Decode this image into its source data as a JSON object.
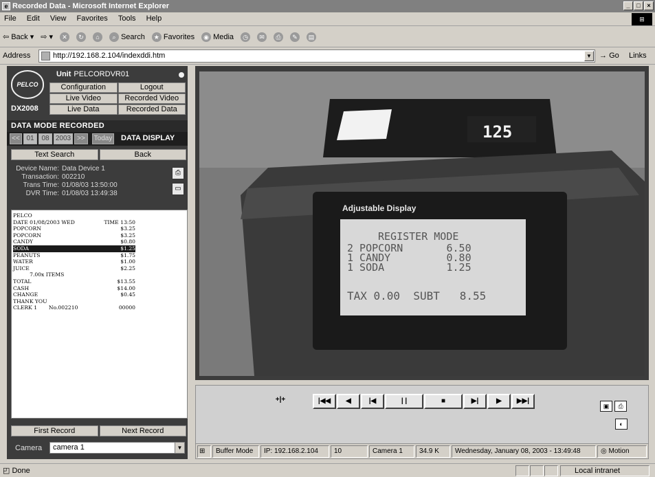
{
  "window": {
    "title": "Recorded Data - Microsoft Internet Explorer"
  },
  "menu": [
    "File",
    "Edit",
    "View",
    "Favorites",
    "Tools",
    "Help"
  ],
  "toolbar": {
    "back": "Back",
    "search": "Search",
    "favorites": "Favorites",
    "media": "Media"
  },
  "address": {
    "label": "Address",
    "url": "http://192.168.2.104/indexddi.htm",
    "go": "Go",
    "links": "Links"
  },
  "unit": {
    "label": "Unit",
    "name": "PELCORDVR01",
    "model": "DX2008",
    "logo": "PELCO"
  },
  "nav": [
    "Configuration",
    "Logout",
    "Live Video",
    "Recorded Video",
    "Live Data",
    "Recorded Data"
  ],
  "mode": "DATA MODE RECORDED",
  "datebar": {
    "prev": "<<",
    "month": "01",
    "day": "08",
    "year": "2003",
    "next": ">>",
    "today": "Today",
    "title": "DATA DISPLAY"
  },
  "actions": {
    "text_search": "Text Search",
    "back": "Back",
    "first_record": "First Record",
    "next_record": "Next Record"
  },
  "device": [
    {
      "k": "Device Name:",
      "v": "Data Device 1"
    },
    {
      "k": "Transaction:",
      "v": "002210"
    },
    {
      "k": "Trans Time:",
      "v": "01/08/03 13:50:00"
    },
    {
      "k": "DVR Time:",
      "v": "01/08/03 13:49:38"
    }
  ],
  "receipt": [
    {
      "l": "PELCO",
      "r": ""
    },
    {
      "l": "DATE 01/08/2003 WED",
      "r": "TIME 13:50"
    },
    {
      "l": "POPCORN",
      "r": "$3.25"
    },
    {
      "l": "POPCORN",
      "r": "$3.25"
    },
    {
      "l": "CANDY",
      "r": "$0.80"
    },
    {
      "l": "SODA",
      "r": "$1.25",
      "selected": true
    },
    {
      "l": "PEANUTS",
      "r": "$1.75"
    },
    {
      "l": "WATER",
      "r": "$1.00"
    },
    {
      "l": "JUICE",
      "r": "$2.25"
    },
    {
      "l": "          7.00x ITEMS",
      "r": ""
    },
    {
      "l": "TOTAL",
      "r": "$13.55"
    },
    {
      "l": "CASH",
      "r": "$14.00"
    },
    {
      "l": "CHANGE",
      "r": "$0.45"
    },
    {
      "l": "THANK YOU",
      "r": ""
    },
    {
      "l": "CLERK 1       No.002210",
      "r": "00000"
    }
  ],
  "camera": {
    "label": "Camera",
    "value": "camera 1"
  },
  "video": {
    "pole_display": "125",
    "display_label": "Adjustable Display",
    "lcd": [
      "REGISTER MODE",
      "2 POPCORN       6.50",
      "1 CANDY         0.80",
      "1 SODA          1.25",
      "TAX 0.00  SUBT   8.55"
    ]
  },
  "status": {
    "mode": "Buffer Mode",
    "ip": "IP: 192.168.2.104",
    "num": "10",
    "camera": "Camera 1",
    "rate": "34.9 K",
    "datetime": "Wednesday, January 08, 2003 - 13:49:48",
    "motion": "Motion"
  },
  "browser_status": {
    "text": "Done",
    "zone": "Local intranet"
  }
}
